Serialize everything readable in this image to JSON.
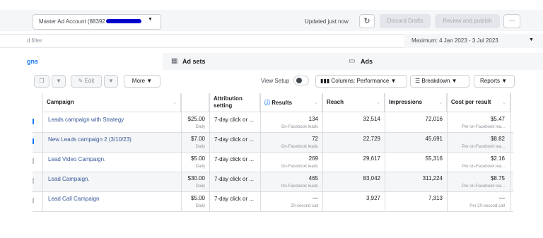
{
  "topbar": {
    "account": "Master Ad Account (88392",
    "updated": "Updated just now",
    "discard": "Discard Drafts",
    "publish": "Review and publish",
    "more": "···"
  },
  "filter": {
    "placeholder": "d filter",
    "date_range": "Maximum: 4 Jan 2023 - 3 Jul 2023"
  },
  "tabs": {
    "campaigns": "gns",
    "adsets": "Ad sets",
    "ads": "Ads"
  },
  "toolbar": {
    "edit": "Edit",
    "more": "More",
    "view_setup": "View Setup",
    "columns": "Columns: Performance",
    "breakdown": "Breakdown",
    "reports": "Reports"
  },
  "table": {
    "headers": {
      "campaign": "Campaign",
      "attribution": "Attribution setting",
      "results": "Results",
      "reach": "Reach",
      "impressions": "Impressions",
      "cpr": "Cost per result"
    },
    "rows": [
      {
        "name": "Leads campaign with Strategy",
        "budget": "$25.00",
        "budget_type": "Daily",
        "attribution": "7-day click or ...",
        "results": "134",
        "results_type": "On-Facebook leads",
        "reach": "32,514",
        "impressions": "72,016",
        "cpr": "$5.47",
        "cpr_type": "Per on-Facebook lea..."
      },
      {
        "name": "New Leads campaign 2 (3/10/23)",
        "budget": "$7.00",
        "budget_type": "Daily",
        "attribution": "7-day click or ...",
        "results": "72",
        "results_type": "On-Facebook leads",
        "reach": "22,729",
        "impressions": "45,691",
        "cpr": "$8.82",
        "cpr_type": "Per on-Facebook lea..."
      },
      {
        "name": "Lead Video Campaign.",
        "budget": "$5.00",
        "budget_type": "Daily",
        "attribution": "7-day click or ...",
        "results": "269",
        "results_type": "On-Facebook leads",
        "reach": "29,617",
        "impressions": "55,316",
        "cpr": "$2.16",
        "cpr_type": "Per on-Facebook lea..."
      },
      {
        "name": "Lead Campaign.",
        "budget": "$30.00",
        "budget_type": "Daily",
        "attribution": "7-day click or ...",
        "results": "465",
        "results_type": "On-Facebook leads",
        "reach": "83,042",
        "impressions": "311,224",
        "cpr": "$8.75",
        "cpr_type": "Per on-Facebook lea..."
      },
      {
        "name": "Lead Call Campaign",
        "budget": "$5.00",
        "budget_type": "Daily",
        "attribution": "7-day click or ...",
        "results": "—",
        "results_type": "20-second call",
        "reach": "3,927",
        "impressions": "7,313",
        "cpr": "—",
        "cpr_type": "Per 20-second call"
      }
    ]
  }
}
